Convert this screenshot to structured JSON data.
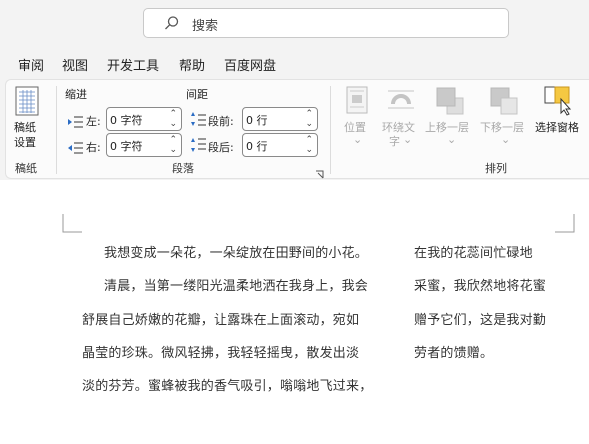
{
  "search": {
    "placeholder": "搜索"
  },
  "tabs": [
    "审阅",
    "视图",
    "开发工具",
    "帮助",
    "百度网盘"
  ],
  "ribbon": {
    "gaozhi": {
      "button_line1": "稿纸",
      "button_line2": "设置",
      "group_label": "稿纸"
    },
    "paragraph": {
      "indent_label": "缩进",
      "spacing_label": "间距",
      "left_label": "左:",
      "left_value": "0 字符",
      "right_label": "右:",
      "right_value": "0 字符",
      "before_label": "段前:",
      "before_value": "0 行",
      "after_label": "段后:",
      "after_value": "0 行",
      "group_label": "段落"
    },
    "arrange": {
      "position_label": "位置",
      "wrap_line1": "环绕文",
      "wrap_line2": "字",
      "forward_label": "上移一层",
      "backward_label": "下移一层",
      "pane_label": "选择窗格",
      "group_label": "排列"
    }
  },
  "document": {
    "col1": [
      "我想变成一朵花，一朵绽放在田野间的小花。",
      "清晨，当第一缕阳光温柔地洒在我身上，我会",
      "舒展自己娇嫩的花瓣，让露珠在上面滚动，宛如",
      "晶莹的珍珠。微风轻拂，我轻轻摇曳，散发出淡",
      "淡的芬芳。蜜蜂被我的香气吸引，嗡嗡地飞过来，"
    ],
    "col2": [
      "在我的花蕊间忙碌地",
      "采蜜，我欣然地将花蜜",
      "赠予它们，这是我对勤",
      "劳者的馈赠。"
    ]
  },
  "colors": {
    "ribbon_bg": "#fbfbfb",
    "app_bg": "#f3f3f3",
    "pane_icon": "#f5c842"
  }
}
